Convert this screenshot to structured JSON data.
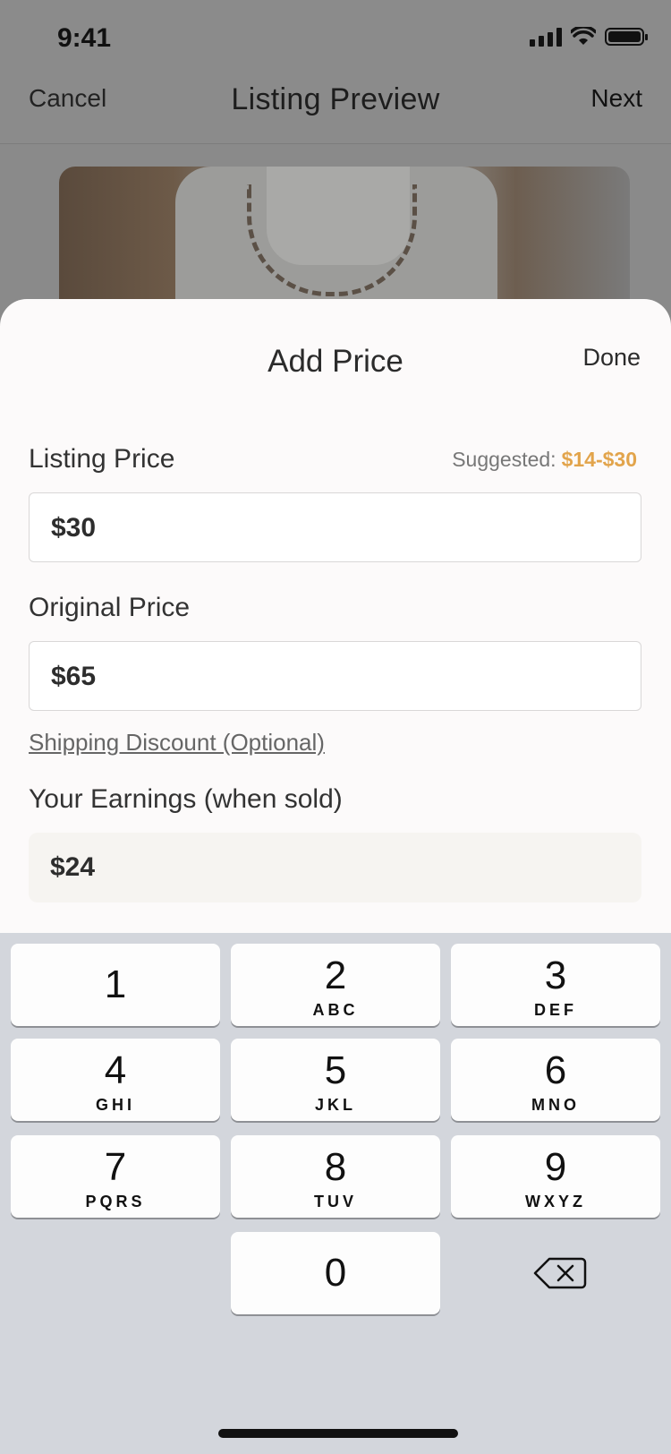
{
  "status_bar": {
    "time": "9:41"
  },
  "nav": {
    "cancel": "Cancel",
    "title": "Listing Preview",
    "next": "Next"
  },
  "sheet": {
    "title": "Add Price",
    "done": "Done",
    "listing_price": {
      "label": "Listing Price",
      "suggested_label": "Suggested:",
      "suggested_range": "$14-$30",
      "value": "$30"
    },
    "original_price": {
      "label": "Original Price",
      "value": "$65"
    },
    "shipping_discount": "Shipping Discount (Optional)",
    "earnings": {
      "label": "Your Earnings (when sold)",
      "value": "$24"
    }
  },
  "keypad": {
    "keys": [
      {
        "digit": "1",
        "letters": ""
      },
      {
        "digit": "2",
        "letters": "ABC"
      },
      {
        "digit": "3",
        "letters": "DEF"
      },
      {
        "digit": "4",
        "letters": "GHI"
      },
      {
        "digit": "5",
        "letters": "JKL"
      },
      {
        "digit": "6",
        "letters": "MNO"
      },
      {
        "digit": "7",
        "letters": "PQRS"
      },
      {
        "digit": "8",
        "letters": "TUV"
      },
      {
        "digit": "9",
        "letters": "WXYZ"
      },
      {
        "digit": "0",
        "letters": ""
      }
    ]
  },
  "colors": {
    "accent": "#e2a44b",
    "overlay": "#8b8b8b",
    "sheet": "#fcfafa",
    "keypad": "#d3d6dc"
  }
}
